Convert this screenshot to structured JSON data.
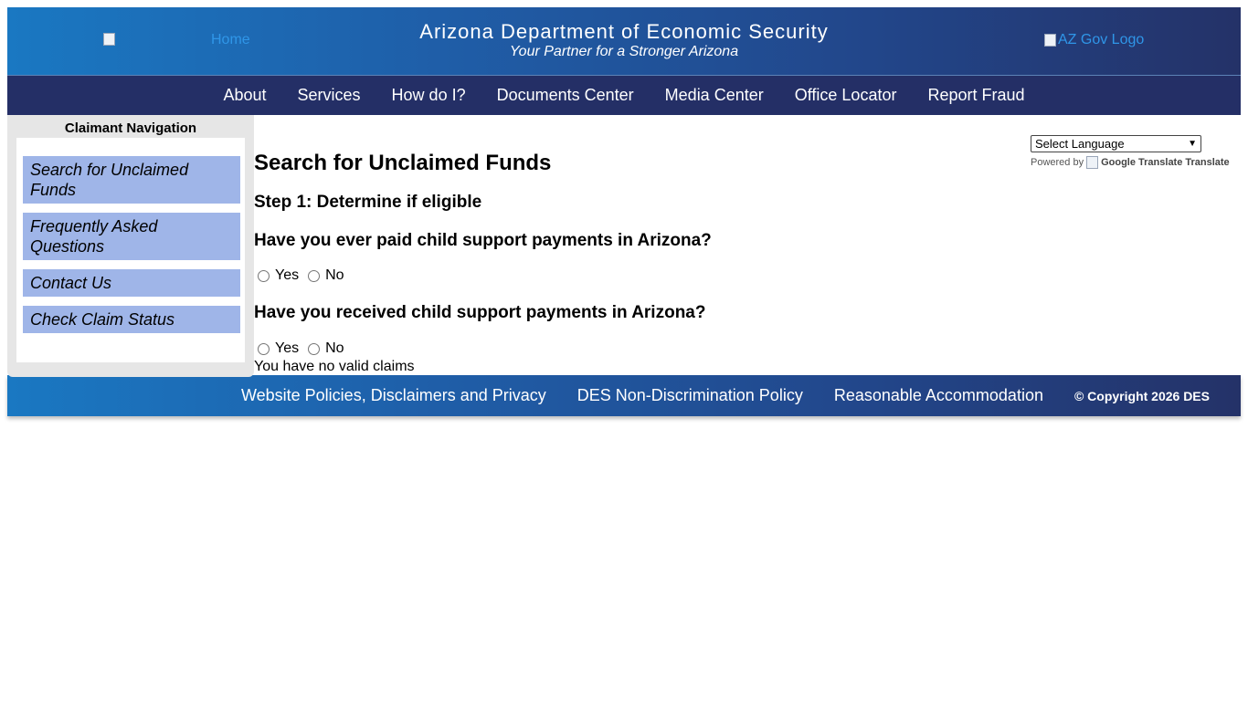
{
  "header": {
    "home_link": "Home",
    "title": "Arizona Department of Economic Security",
    "tagline": "Your Partner for a Stronger Arizona",
    "gov_logo_alt": "AZ Gov Logo"
  },
  "nav": {
    "items": [
      "About",
      "Services",
      "How do I?",
      "Documents Center",
      "Media Center",
      "Office Locator",
      "Report Fraud"
    ]
  },
  "sidebar": {
    "title": "Claimant Navigation",
    "links": [
      "Search for Unclaimed Funds",
      "Frequently Asked Questions",
      "Contact Us",
      "Check Claim Status"
    ]
  },
  "main": {
    "title": "Search for Unclaimed Funds",
    "step": "Step 1: Determine if eligible",
    "q1": "Have you ever paid child support payments in Arizona?",
    "q2": "Have you received child support payments in Arizona?",
    "yes": "Yes",
    "no": "No",
    "no_claims": "You have no valid claims"
  },
  "translate": {
    "select_label": "Select Language",
    "powered_by": "Powered by",
    "google_alt": "Google Translate",
    "translate": "Translate"
  },
  "footer": {
    "links": [
      "Website Policies, Disclaimers and Privacy",
      "DES Non-Discrimination Policy",
      "Reasonable Accommodation"
    ],
    "copyright": "© Copyright 2026 DES"
  },
  "colors": {
    "nav_bg": "#242f66",
    "sidebar_link_bg": "#9fb5e8",
    "link_blue": "#2f96e8"
  }
}
